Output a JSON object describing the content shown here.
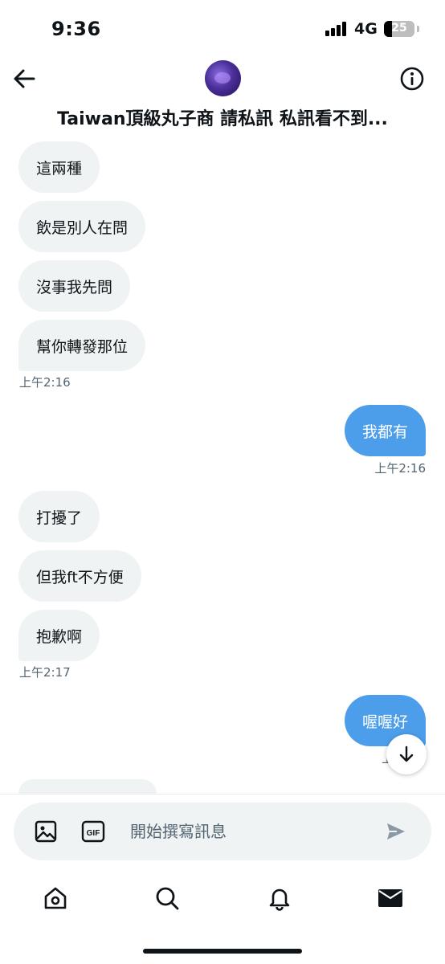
{
  "status_bar": {
    "time": "9:36",
    "network": "4G",
    "battery": "25",
    "battery_fraction": 0.25
  },
  "header": {
    "title": "Taiwan頂級丸子商 請私訊 私訊看不到..."
  },
  "messages": [
    {
      "text": "這兩種"
    },
    {
      "text": "飲是別人在問"
    },
    {
      "text": "沒事我先問"
    },
    {
      "text": "幫你轉發那位"
    },
    {
      "time": "上午2:16"
    },
    {
      "text": "我都有"
    },
    {
      "time": "上午2:16"
    },
    {
      "text": "打擾了"
    },
    {
      "text": "但我ft不方便"
    },
    {
      "text": "抱歉啊"
    },
    {
      "time": "上午2:17"
    },
    {
      "text": "喔喔好"
    },
    {
      "time": "上"
    }
  ],
  "composer": {
    "placeholder": "開始撰寫訊息"
  },
  "icons": {
    "back": "arrow-left-icon",
    "info": "info-icon",
    "media": "image-icon",
    "gif": "gif-icon",
    "send": "send-icon",
    "scroll": "arrow-down-icon",
    "nav": [
      "home-icon",
      "search-icon",
      "bell-icon",
      "mail-icon"
    ]
  },
  "colors": {
    "outgoing_bubble": "#4c9eeb",
    "incoming_bubble": "#eff3f4",
    "secondary_text": "#536471"
  }
}
